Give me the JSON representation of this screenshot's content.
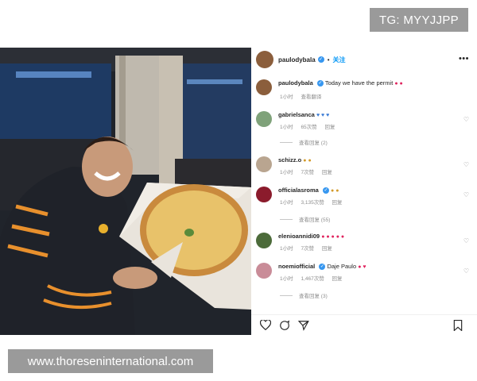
{
  "watermark_top": "TG: MYYJJPP",
  "watermark_bottom": "www.thoreseninternational.com",
  "post": {
    "username": "paulodybala",
    "follow_label": "关注",
    "caption_user": "paulodybala",
    "caption_text": "Today we have the permit",
    "caption_time": "1小时",
    "caption_translate": "查看翻译"
  },
  "comments": [
    {
      "user": "gabrielsanca",
      "text": "",
      "time": "1小时",
      "likes": "65次赞",
      "reply": "回复",
      "view_replies": "查看回复 (2)",
      "avatar_color": "#7fa27a"
    },
    {
      "user": "schizz.o",
      "text": "",
      "time": "1小时",
      "likes": "7次赞",
      "reply": "回复",
      "view_replies": "",
      "avatar_color": "#b9a590"
    },
    {
      "user": "officialasroma",
      "text": "",
      "time": "1小时",
      "likes": "3,135次赞",
      "reply": "回复",
      "view_replies": "查看回复 (55)",
      "avatar_color": "#8b1b2c"
    },
    {
      "user": "elenioannidi09",
      "text": "",
      "time": "1小时",
      "likes": "7次赞",
      "reply": "回复",
      "view_replies": "",
      "avatar_color": "#4c6b3a"
    },
    {
      "user": "noemiofficial",
      "text": "Daje Paulo",
      "time": "1小时",
      "likes": "1,467次赞",
      "reply": "回复",
      "view_replies": "查看回复 (3)",
      "avatar_color": "#c98c98"
    }
  ],
  "icons": {
    "more": "more-options-icon",
    "like": "heart-icon",
    "comment": "comment-icon",
    "share": "share-icon",
    "save": "bookmark-icon"
  },
  "colors": {
    "verified": "#3797f0",
    "follow": "#0095f6",
    "watermark_bg": "#9a9a9a"
  }
}
